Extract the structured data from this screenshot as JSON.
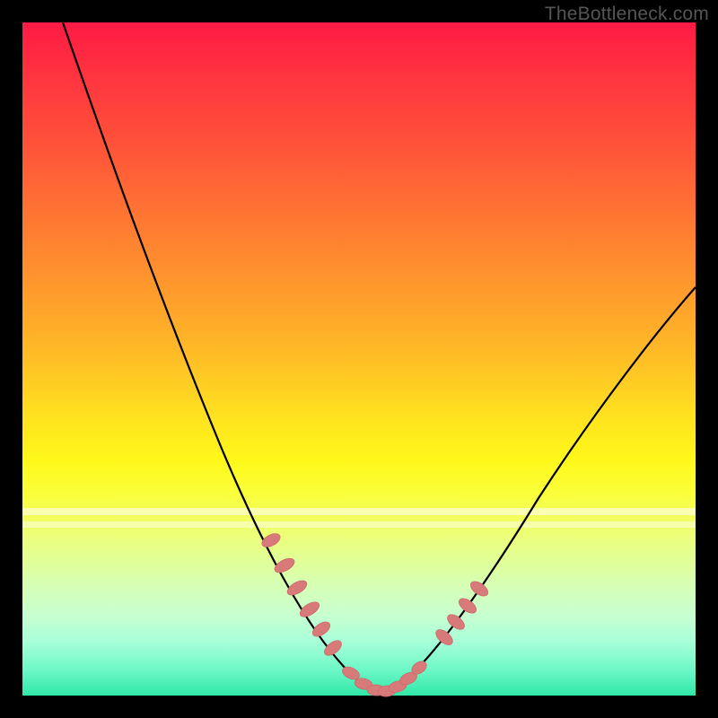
{
  "watermark": "TheBottleneck.com",
  "colors": {
    "frame": "#000000",
    "curve": "#000000",
    "bead_fill": "#d97a7a",
    "bead_stroke": "#c96a6a"
  },
  "chart_data": {
    "type": "line",
    "title": "",
    "xlabel": "",
    "ylabel": "",
    "xlim": [
      0,
      100
    ],
    "ylim": [
      0,
      100
    ],
    "note": "V-shaped bottleneck curve; y represents mismatch (higher = worse), minimum near x≈53. Values estimated from pixel positions.",
    "series": [
      {
        "name": "curve",
        "x": [
          6,
          10,
          15,
          20,
          25,
          30,
          35,
          40,
          44,
          47,
          49,
          50,
          51,
          52,
          53,
          54,
          55,
          56,
          58,
          60,
          63,
          65,
          70,
          75,
          80,
          85,
          90,
          95,
          100
        ],
        "y": [
          100,
          90,
          78,
          66,
          55,
          44,
          34,
          24,
          16,
          10,
          6,
          4,
          3,
          2,
          1.5,
          2,
          2.5,
          3.5,
          6,
          9,
          14,
          18,
          27,
          35,
          43,
          50,
          56,
          61,
          64
        ]
      }
    ],
    "beads": {
      "note": "Highlighted segments on the curve (salmon capsules).",
      "left_cluster_x": [
        37,
        39.5,
        41.5,
        43.5,
        45,
        46.5
      ],
      "bottom_cluster_x": [
        49,
        50.5,
        52,
        53.5,
        55,
        56.5,
        58
      ],
      "right_cluster_x": [
        62,
        63.5,
        65,
        66.5
      ]
    },
    "bands": {
      "note": "Faint horizontal white bands near bottom of gradient (y as % from top).",
      "positions_pct": [
        72.5,
        74.5
      ]
    }
  }
}
